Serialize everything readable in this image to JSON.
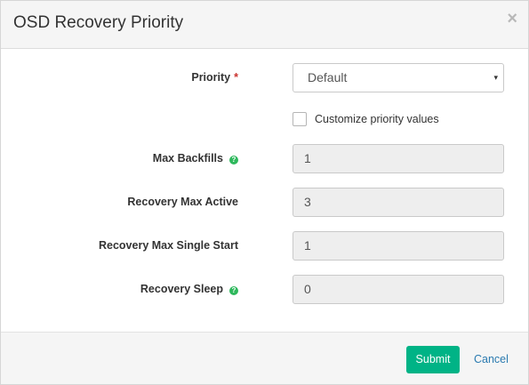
{
  "dialog": {
    "title": "OSD Recovery Priority",
    "close_glyph": "×"
  },
  "form": {
    "priority": {
      "label": "Priority",
      "required_marker": "*",
      "selected": "Default",
      "caret_glyph": "▾"
    },
    "customize": {
      "label": "Customize priority values",
      "checked": false
    },
    "fields": [
      {
        "label": "Max Backfills",
        "value": "1",
        "has_help": true
      },
      {
        "label": "Recovery Max Active",
        "value": "3",
        "has_help": false
      },
      {
        "label": "Recovery Max Single Start",
        "value": "1",
        "has_help": false
      },
      {
        "label": "Recovery Sleep",
        "value": "0",
        "has_help": true
      }
    ],
    "help_glyph": "?"
  },
  "footer": {
    "submit_label": "Submit",
    "cancel_label": "Cancel"
  },
  "colors": {
    "submit_bg": "#00b386",
    "cancel_link": "#2a7ab0",
    "help_icon": "#2eb85c",
    "required": "#c9302c"
  }
}
